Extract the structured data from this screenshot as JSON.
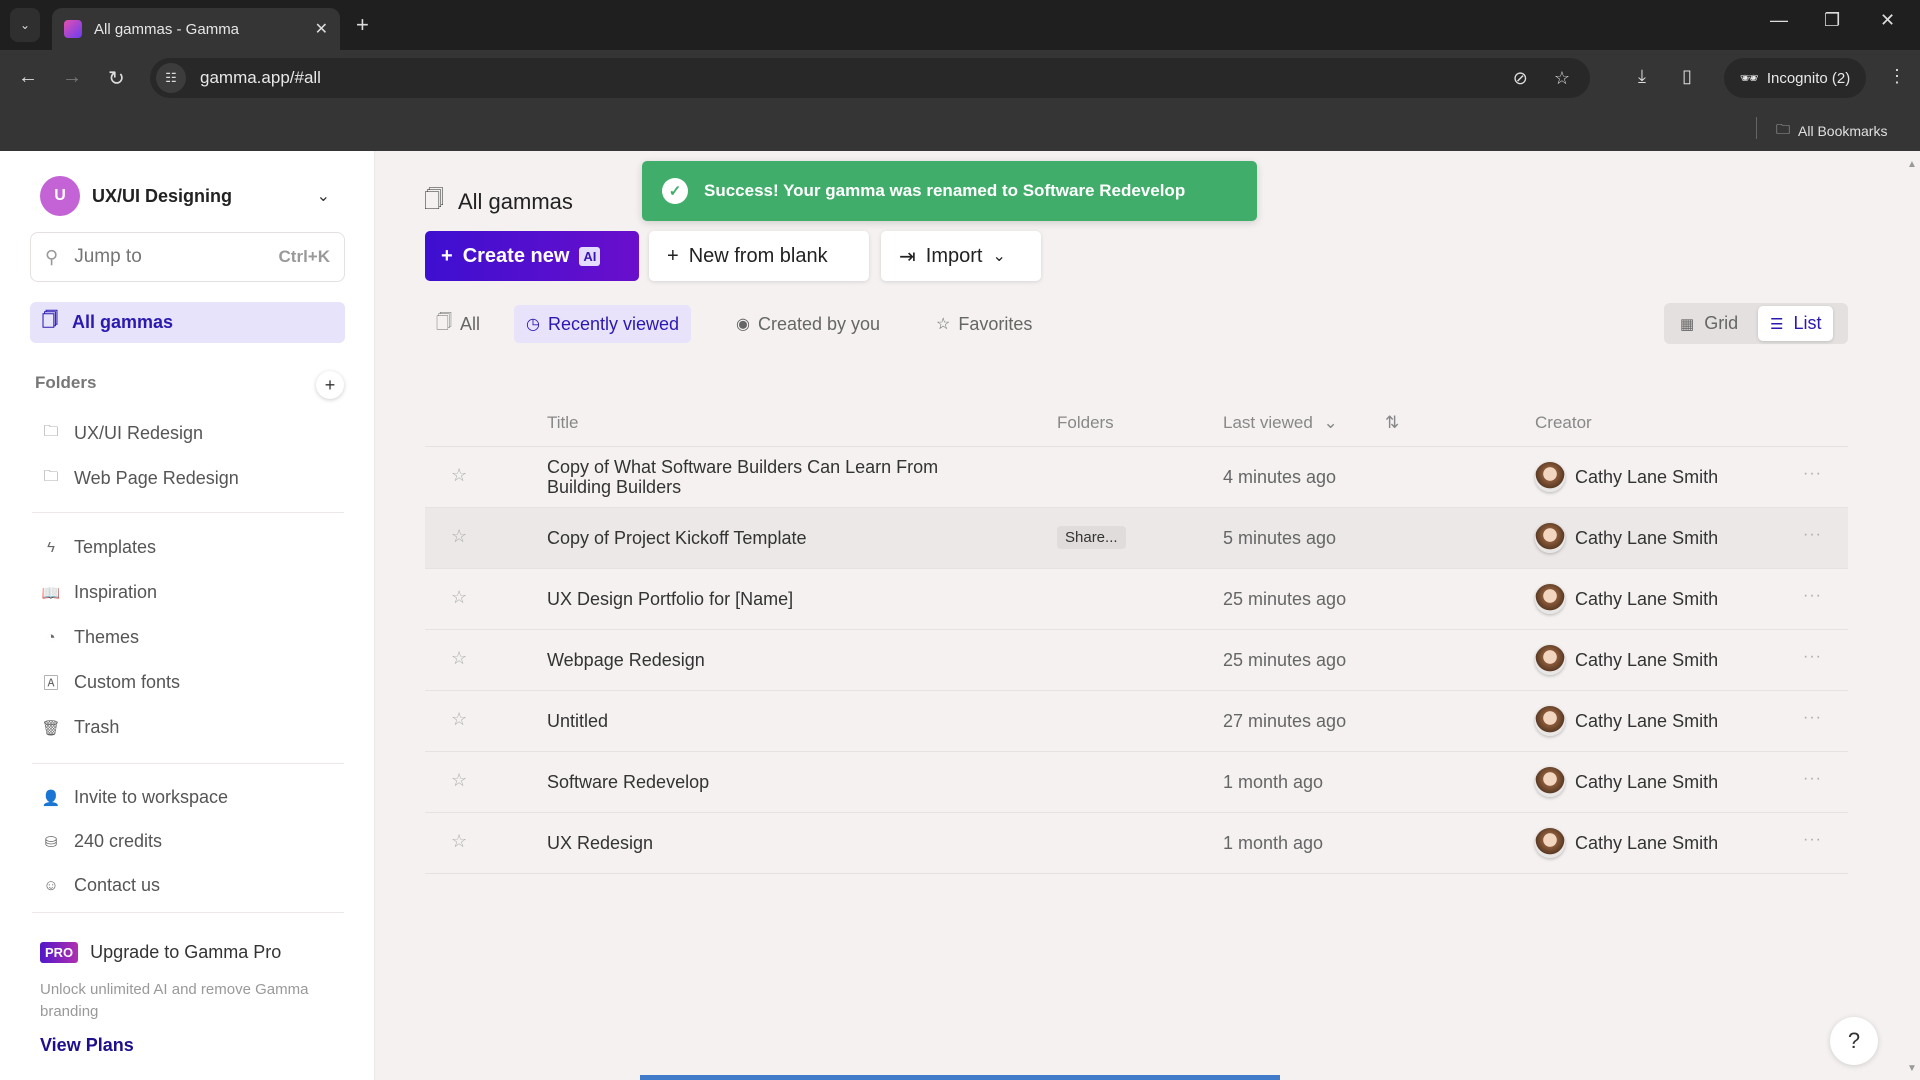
{
  "browser": {
    "tab_title": "All gammas - Gamma",
    "url": "gamma.app/#all",
    "incognito_label": "Incognito (2)",
    "bookmarks_label": "All Bookmarks"
  },
  "sidebar": {
    "workspace_initial": "U",
    "workspace_name": "UX/UI Designing",
    "jump_placeholder": "Jump to",
    "jump_shortcut": "Ctrl+K",
    "active_item": "All gammas",
    "folders_heading": "Folders",
    "folders": [
      {
        "label": "UX/UI Redesign",
        "icon": "folder-icon"
      },
      {
        "label": "Web Page Redesign",
        "icon": "folder-icon"
      }
    ],
    "nav_items": [
      {
        "label": "Templates",
        "icon": "bolt-icon"
      },
      {
        "label": "Inspiration",
        "icon": "book-icon"
      },
      {
        "label": "Themes",
        "icon": "palette-icon"
      },
      {
        "label": "Custom fonts",
        "icon": "font-icon"
      },
      {
        "label": "Trash",
        "icon": "trash-icon"
      }
    ],
    "bottom_items": [
      {
        "label": "Invite to workspace",
        "icon": "user-plus-icon"
      },
      {
        "label": "240 credits",
        "icon": "coins-icon"
      },
      {
        "label": "Contact us",
        "icon": "chat-icon"
      }
    ],
    "pro_badge": "PRO",
    "pro_title": "Upgrade to Gamma Pro",
    "pro_desc": "Unlock unlimited AI and remove Gamma branding",
    "view_plans": "View Plans"
  },
  "main": {
    "title": "All gammas",
    "toast": "Success! Your gamma was renamed to Software Redevelop",
    "create_new": "Create new",
    "ai_badge": "AI",
    "new_from_blank": "New from blank",
    "import": "Import",
    "filters": [
      {
        "label": "All",
        "active": false
      },
      {
        "label": "Recently viewed",
        "active": true
      },
      {
        "label": "Created by you",
        "active": false
      },
      {
        "label": "Favorites",
        "active": false
      }
    ],
    "view_grid": "Grid",
    "view_list": "List",
    "active_view": "List",
    "columns": {
      "title": "Title",
      "folders": "Folders",
      "last_viewed": "Last viewed",
      "creator": "Creator"
    },
    "share_tooltip": "Share...",
    "rows": [
      {
        "title": "Copy of What Software Builders Can Learn From Building Builders",
        "last_viewed": "4 minutes ago",
        "creator": "Cathy Lane Smith"
      },
      {
        "title": "Copy of Project Kickoff Template",
        "last_viewed": "5 minutes ago",
        "creator": "Cathy Lane Smith"
      },
      {
        "title": "UX Design Portfolio for [Name]",
        "last_viewed": "25 minutes ago",
        "creator": "Cathy Lane Smith"
      },
      {
        "title": "Webpage Redesign",
        "last_viewed": "25 minutes ago",
        "creator": "Cathy Lane Smith"
      },
      {
        "title": "Untitled",
        "last_viewed": "27 minutes ago",
        "creator": "Cathy Lane Smith"
      },
      {
        "title": "Software Redevelop",
        "last_viewed": "1 month ago",
        "creator": "Cathy Lane Smith"
      },
      {
        "title": "UX Redesign",
        "last_viewed": "1 month ago",
        "creator": "Cathy Lane Smith"
      }
    ],
    "help": "?"
  },
  "colors": {
    "accent": "#2b18b2",
    "toast": "#41ad6a",
    "active_bg": "#e7e3fb"
  }
}
